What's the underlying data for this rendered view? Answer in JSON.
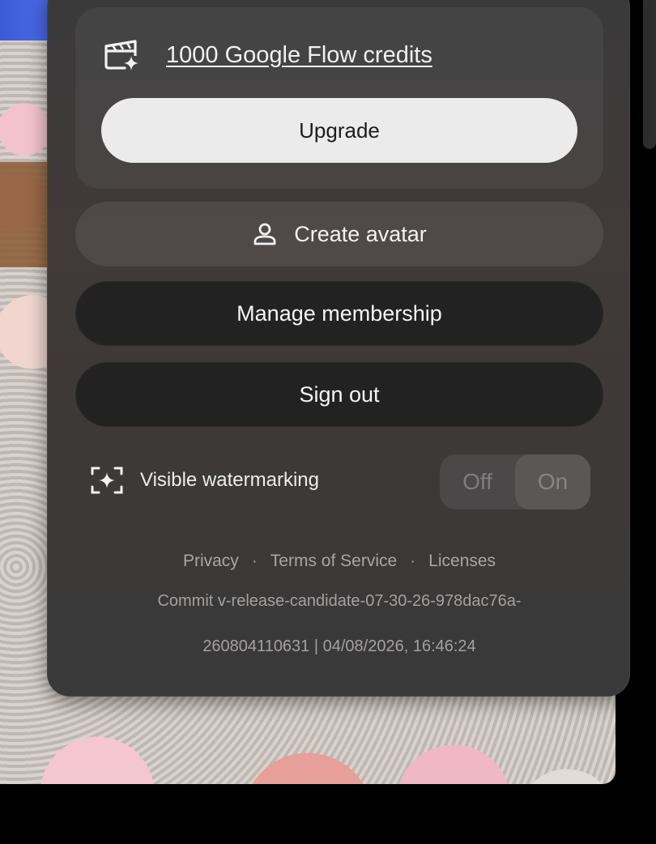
{
  "credits": {
    "label": "1000 Google Flow credits",
    "upgrade_label": "Upgrade"
  },
  "actions": {
    "create_avatar": "Create avatar",
    "manage_membership": "Manage membership",
    "sign_out": "Sign out"
  },
  "watermark": {
    "label": "Visible watermarking",
    "off_label": "Off",
    "on_label": "On",
    "selected": "On"
  },
  "footer": {
    "privacy": "Privacy",
    "separator": "·",
    "terms": "Terms of Service",
    "licenses": "Licenses",
    "commit_line1": "Commit v-release-candidate-07-30-26-978dac76a-",
    "commit_line2": "260804110631 | 04/08/2026, 16:46:24"
  },
  "icons": {
    "credits": "film-sparkle-icon",
    "avatar": "person-icon",
    "watermark": "frame-sparkle-icon"
  },
  "colors": {
    "panel": "#3b3939",
    "upgrade_button": "#ebebeb",
    "dark_button": "#222222"
  }
}
